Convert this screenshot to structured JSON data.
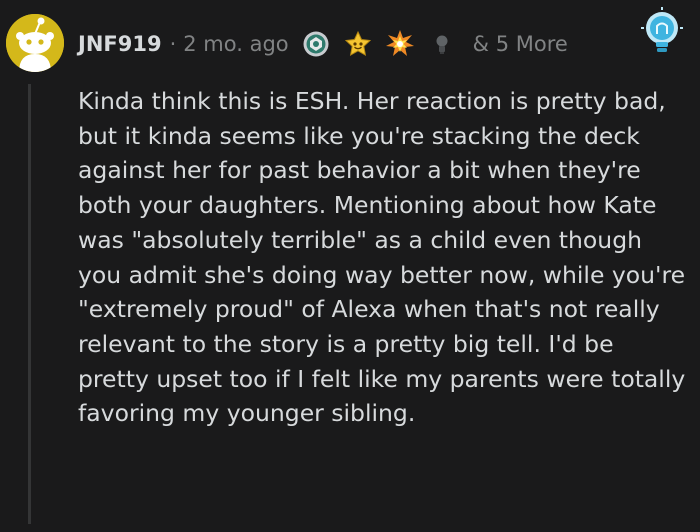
{
  "comment": {
    "username": "JNF919",
    "separator": "·",
    "time_ago": "2 mo. ago",
    "more_awards": "& 5 More",
    "body": "Kinda think this is ESH. Her reaction is pretty bad, but it kinda seems like you're stacking the deck against her for past behavior a bit when they're both your daughters. Mentioning about how Kate was \"absolutely terrible\" as a child even though you admit she's doing way better now, while you're \"extremely proud\" of Alexa when that's not really relevant to the story is a pretty big tell. I'd be pretty upset too if I felt like my parents were totally favoring my younger sibling."
  },
  "icons": {
    "avatar": "snoo-avatar-icon",
    "awards": [
      "silver-award-icon",
      "wholesome-award-icon",
      "mind-blown-award-icon",
      "lightbulb-dark-award-icon"
    ],
    "flair": "lightbulb-flair-icon"
  },
  "colors": {
    "background": "#1a1a1b",
    "text": "#d7dadc",
    "meta": "#818384",
    "avatar": "#d4b81a",
    "flair": "#3fb4e0"
  }
}
